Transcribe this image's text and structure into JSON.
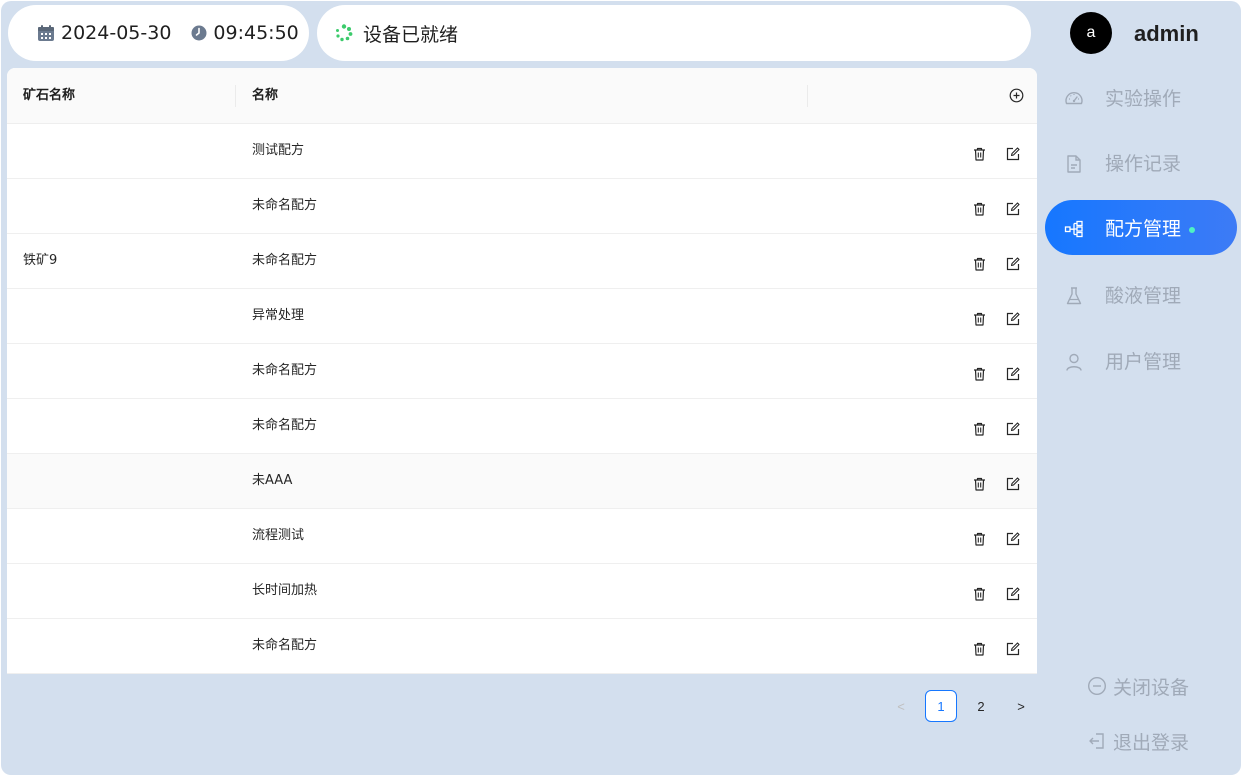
{
  "header": {
    "date": "2024-05-30",
    "time": "09:45:50",
    "status": "设备已就绪"
  },
  "user": {
    "avatar_letter": "a",
    "name": "admin"
  },
  "table": {
    "columns": [
      "矿石名称",
      "名称"
    ],
    "rows": [
      {
        "ore": "",
        "name": "测试配方"
      },
      {
        "ore": "",
        "name": "未命名配方"
      },
      {
        "ore": "铁矿9",
        "name": "未命名配方"
      },
      {
        "ore": "",
        "name": "异常处理"
      },
      {
        "ore": "",
        "name": "未命名配方"
      },
      {
        "ore": "",
        "name": "未命名配方"
      },
      {
        "ore": "",
        "name": "未AAA"
      },
      {
        "ore": "",
        "name": "流程测试"
      },
      {
        "ore": "",
        "name": "长时间加热"
      },
      {
        "ore": "",
        "name": "未命名配方"
      }
    ]
  },
  "pagination": {
    "prev": "<",
    "pages": [
      "1",
      "2"
    ],
    "current": "1",
    "next": ">"
  },
  "nav": {
    "items": [
      {
        "label": "实验操作",
        "icon": "gauge-icon"
      },
      {
        "label": "操作记录",
        "icon": "document-icon"
      },
      {
        "label": "配方管理",
        "icon": "flow-icon",
        "active": true
      },
      {
        "label": "酸液管理",
        "icon": "flask-icon"
      },
      {
        "label": "用户管理",
        "icon": "user-icon"
      }
    ],
    "shutdown": "关闭设备",
    "logout": "退出登录"
  },
  "colors": {
    "background": "#d3dfee",
    "accent": "#1677ff",
    "muted_text": "#a0aab8",
    "active_dot": "#4ef2c3"
  }
}
